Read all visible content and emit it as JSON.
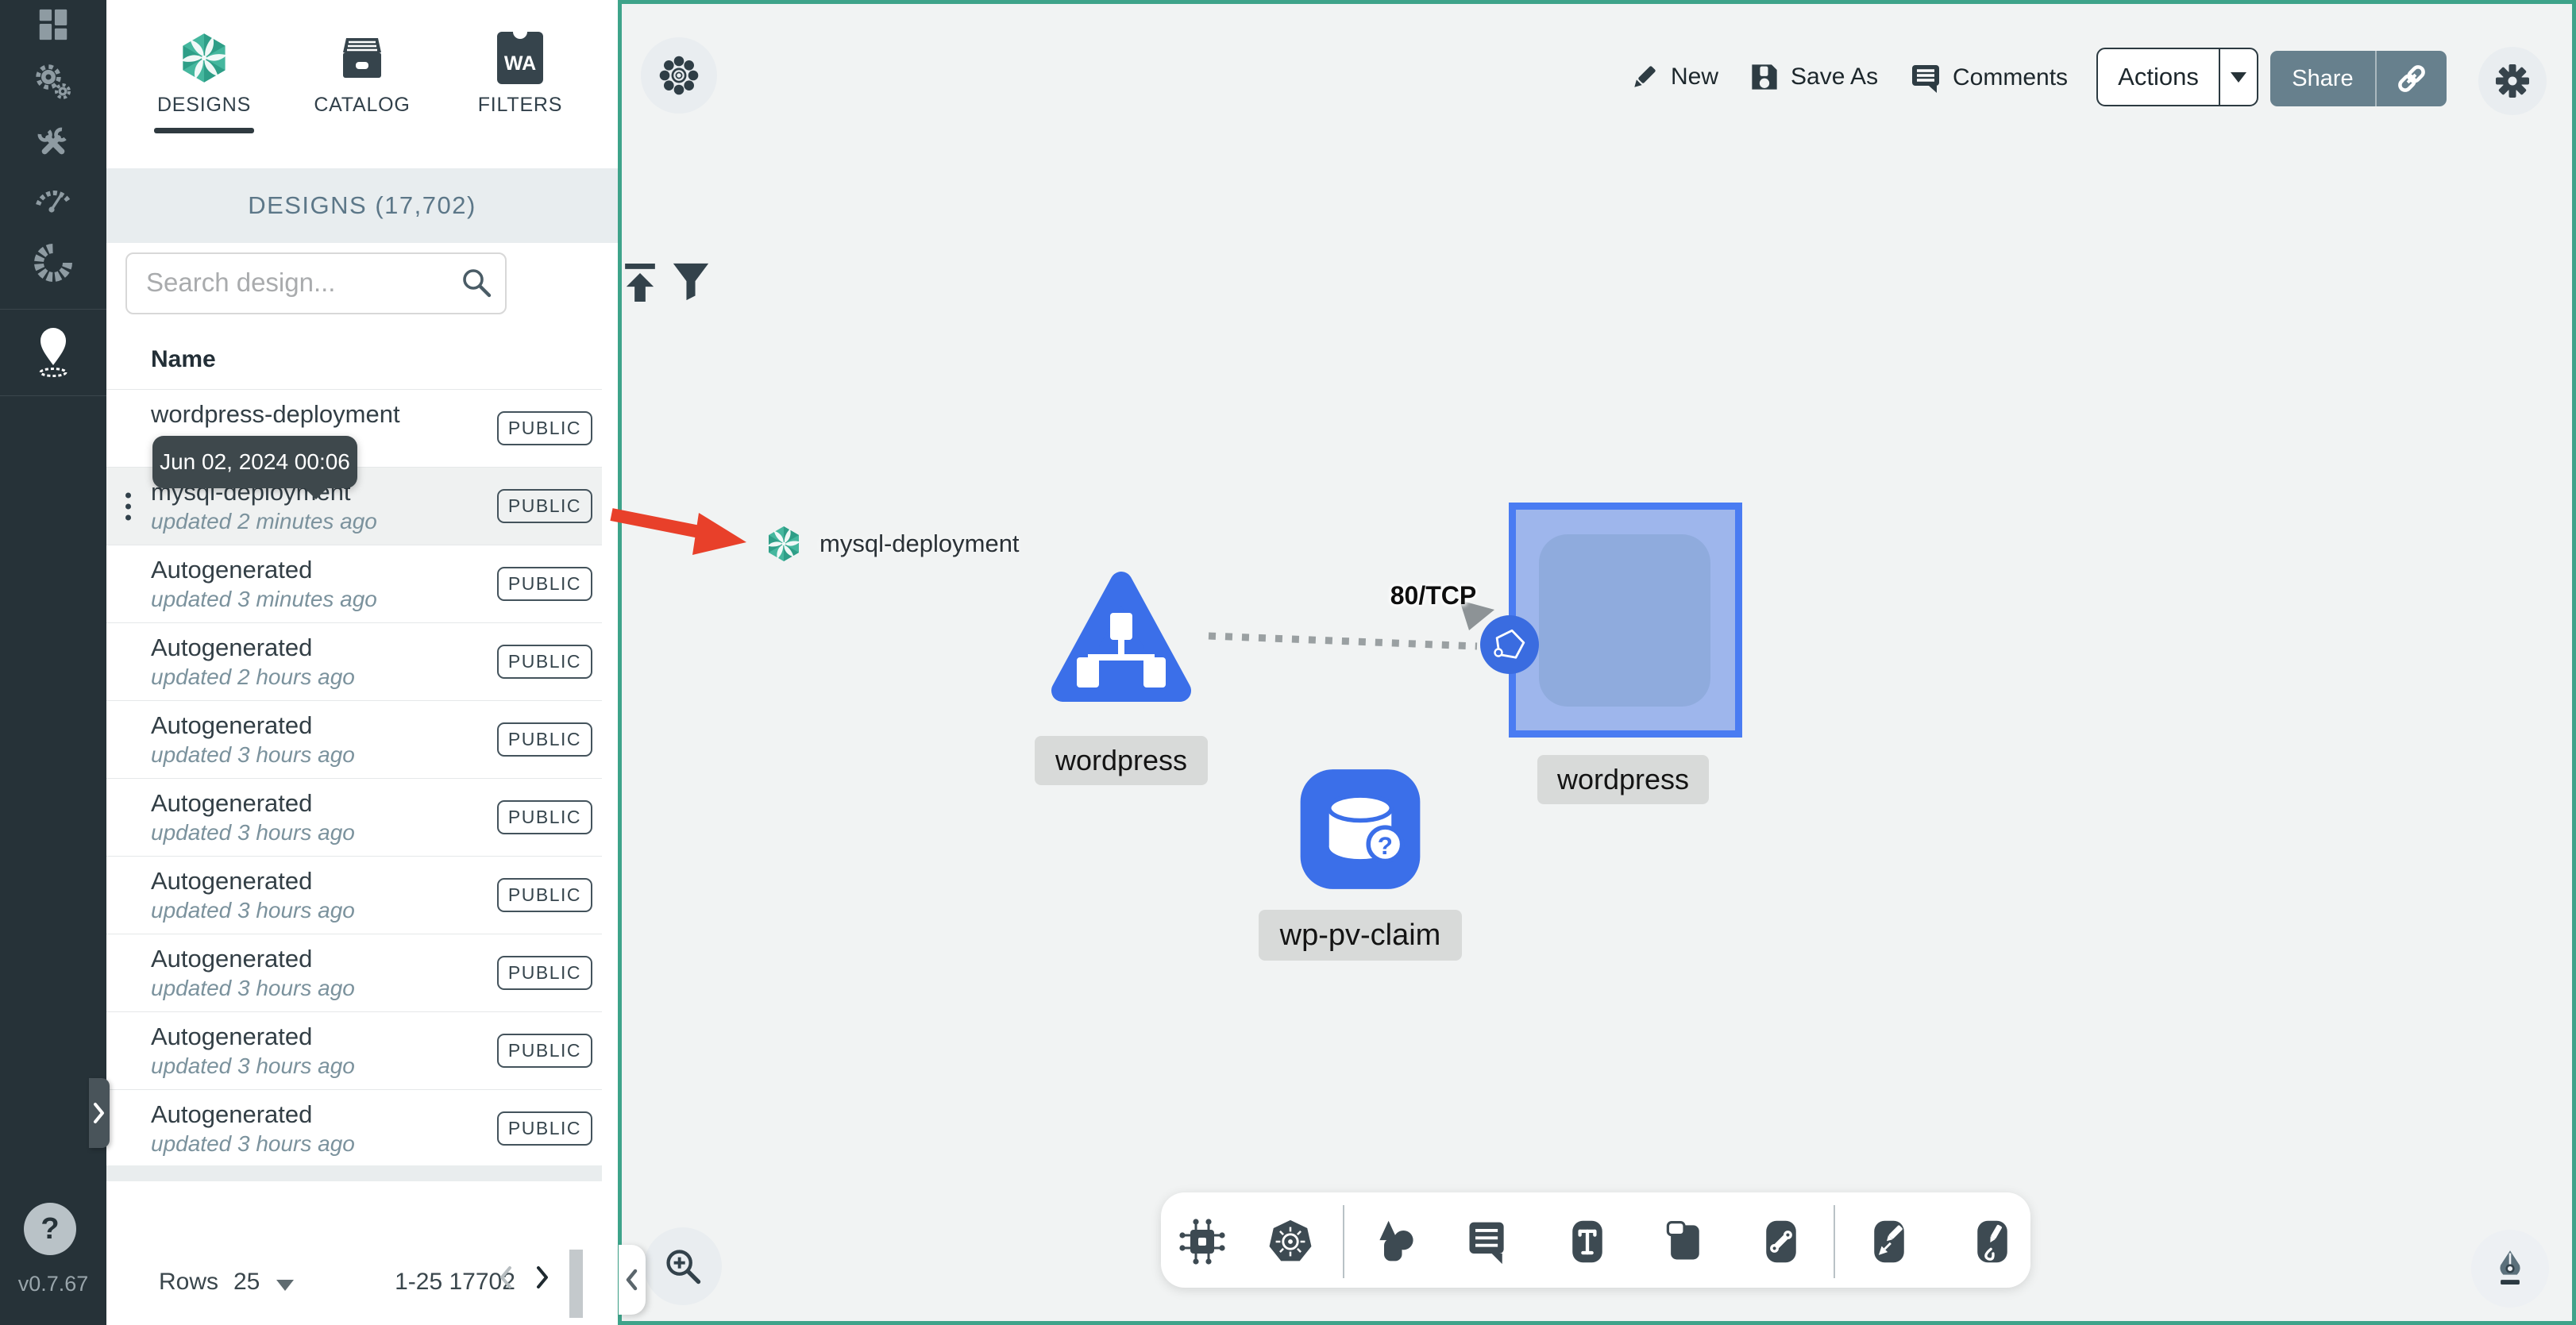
{
  "version": "v0.7.67",
  "colors": {
    "sidebar_bg": "#263238",
    "canvas_border_teal": "#3EA38A",
    "node_blue": "#3B6FE9",
    "selection_blue": "#4A7CF2",
    "arrow_red": "#E8402A"
  },
  "sidebar": {
    "items": [
      {
        "icon": "dashboard-icon"
      },
      {
        "icon": "lifecycle-gears-icon"
      },
      {
        "icon": "configuration-wrench-icon"
      },
      {
        "icon": "performance-speedometer-icon"
      },
      {
        "icon": "extensions-donut-icon"
      },
      {
        "icon": "map-pin-icon",
        "active": true
      }
    ],
    "help_label": "?"
  },
  "tabs": [
    {
      "label": "DESIGNS",
      "icon": "meshery-spiral-icon",
      "active": true
    },
    {
      "label": "CATALOG",
      "icon": "catalog-archive-icon"
    },
    {
      "label": "FILTERS",
      "icon": "wasm-filter-icon",
      "icon_text": "WA"
    }
  ],
  "panel": {
    "header": "DESIGNS (17,702)",
    "search_placeholder": "Search design...",
    "name_header": "Name",
    "tooltip": "Jun 02, 2024 00:06",
    "rows": [
      {
        "name": "wordpress-deployment",
        "updated": "",
        "badge": "PUBLIC"
      },
      {
        "name": "mysql-deployment",
        "updated": "updated 2 minutes ago",
        "badge": "PUBLIC",
        "highlight": true,
        "kebab": true
      },
      {
        "name": "Autogenerated",
        "updated": "updated 3 minutes ago",
        "badge": "PUBLIC"
      },
      {
        "name": "Autogenerated",
        "updated": "updated 2 hours ago",
        "badge": "PUBLIC"
      },
      {
        "name": "Autogenerated",
        "updated": "updated 3 hours ago",
        "badge": "PUBLIC"
      },
      {
        "name": "Autogenerated",
        "updated": "updated 3 hours ago",
        "badge": "PUBLIC"
      },
      {
        "name": "Autogenerated",
        "updated": "updated 3 hours ago",
        "badge": "PUBLIC"
      },
      {
        "name": "Autogenerated",
        "updated": "updated 3 hours ago",
        "badge": "PUBLIC"
      },
      {
        "name": "Autogenerated",
        "updated": "updated 3 hours ago",
        "badge": "PUBLIC"
      },
      {
        "name": "Autogenerated",
        "updated": "updated 3 hours ago",
        "badge": "PUBLIC"
      }
    ],
    "footer": {
      "rows_label": "Rows",
      "per_page": "25",
      "range": "1-25 17702"
    }
  },
  "topbar": {
    "new": "New",
    "save_as": "Save As",
    "comments": "Comments",
    "actions": "Actions",
    "share": "Share"
  },
  "canvas": {
    "design_name_label": "mysql-deployment",
    "edge_label": "80/TCP",
    "nodes": [
      {
        "type": "service",
        "label": "wordpress"
      },
      {
        "type": "deployment-selected",
        "label": "wordpress"
      },
      {
        "type": "persistent-volume-claim",
        "label": "wp-pv-claim"
      }
    ]
  }
}
